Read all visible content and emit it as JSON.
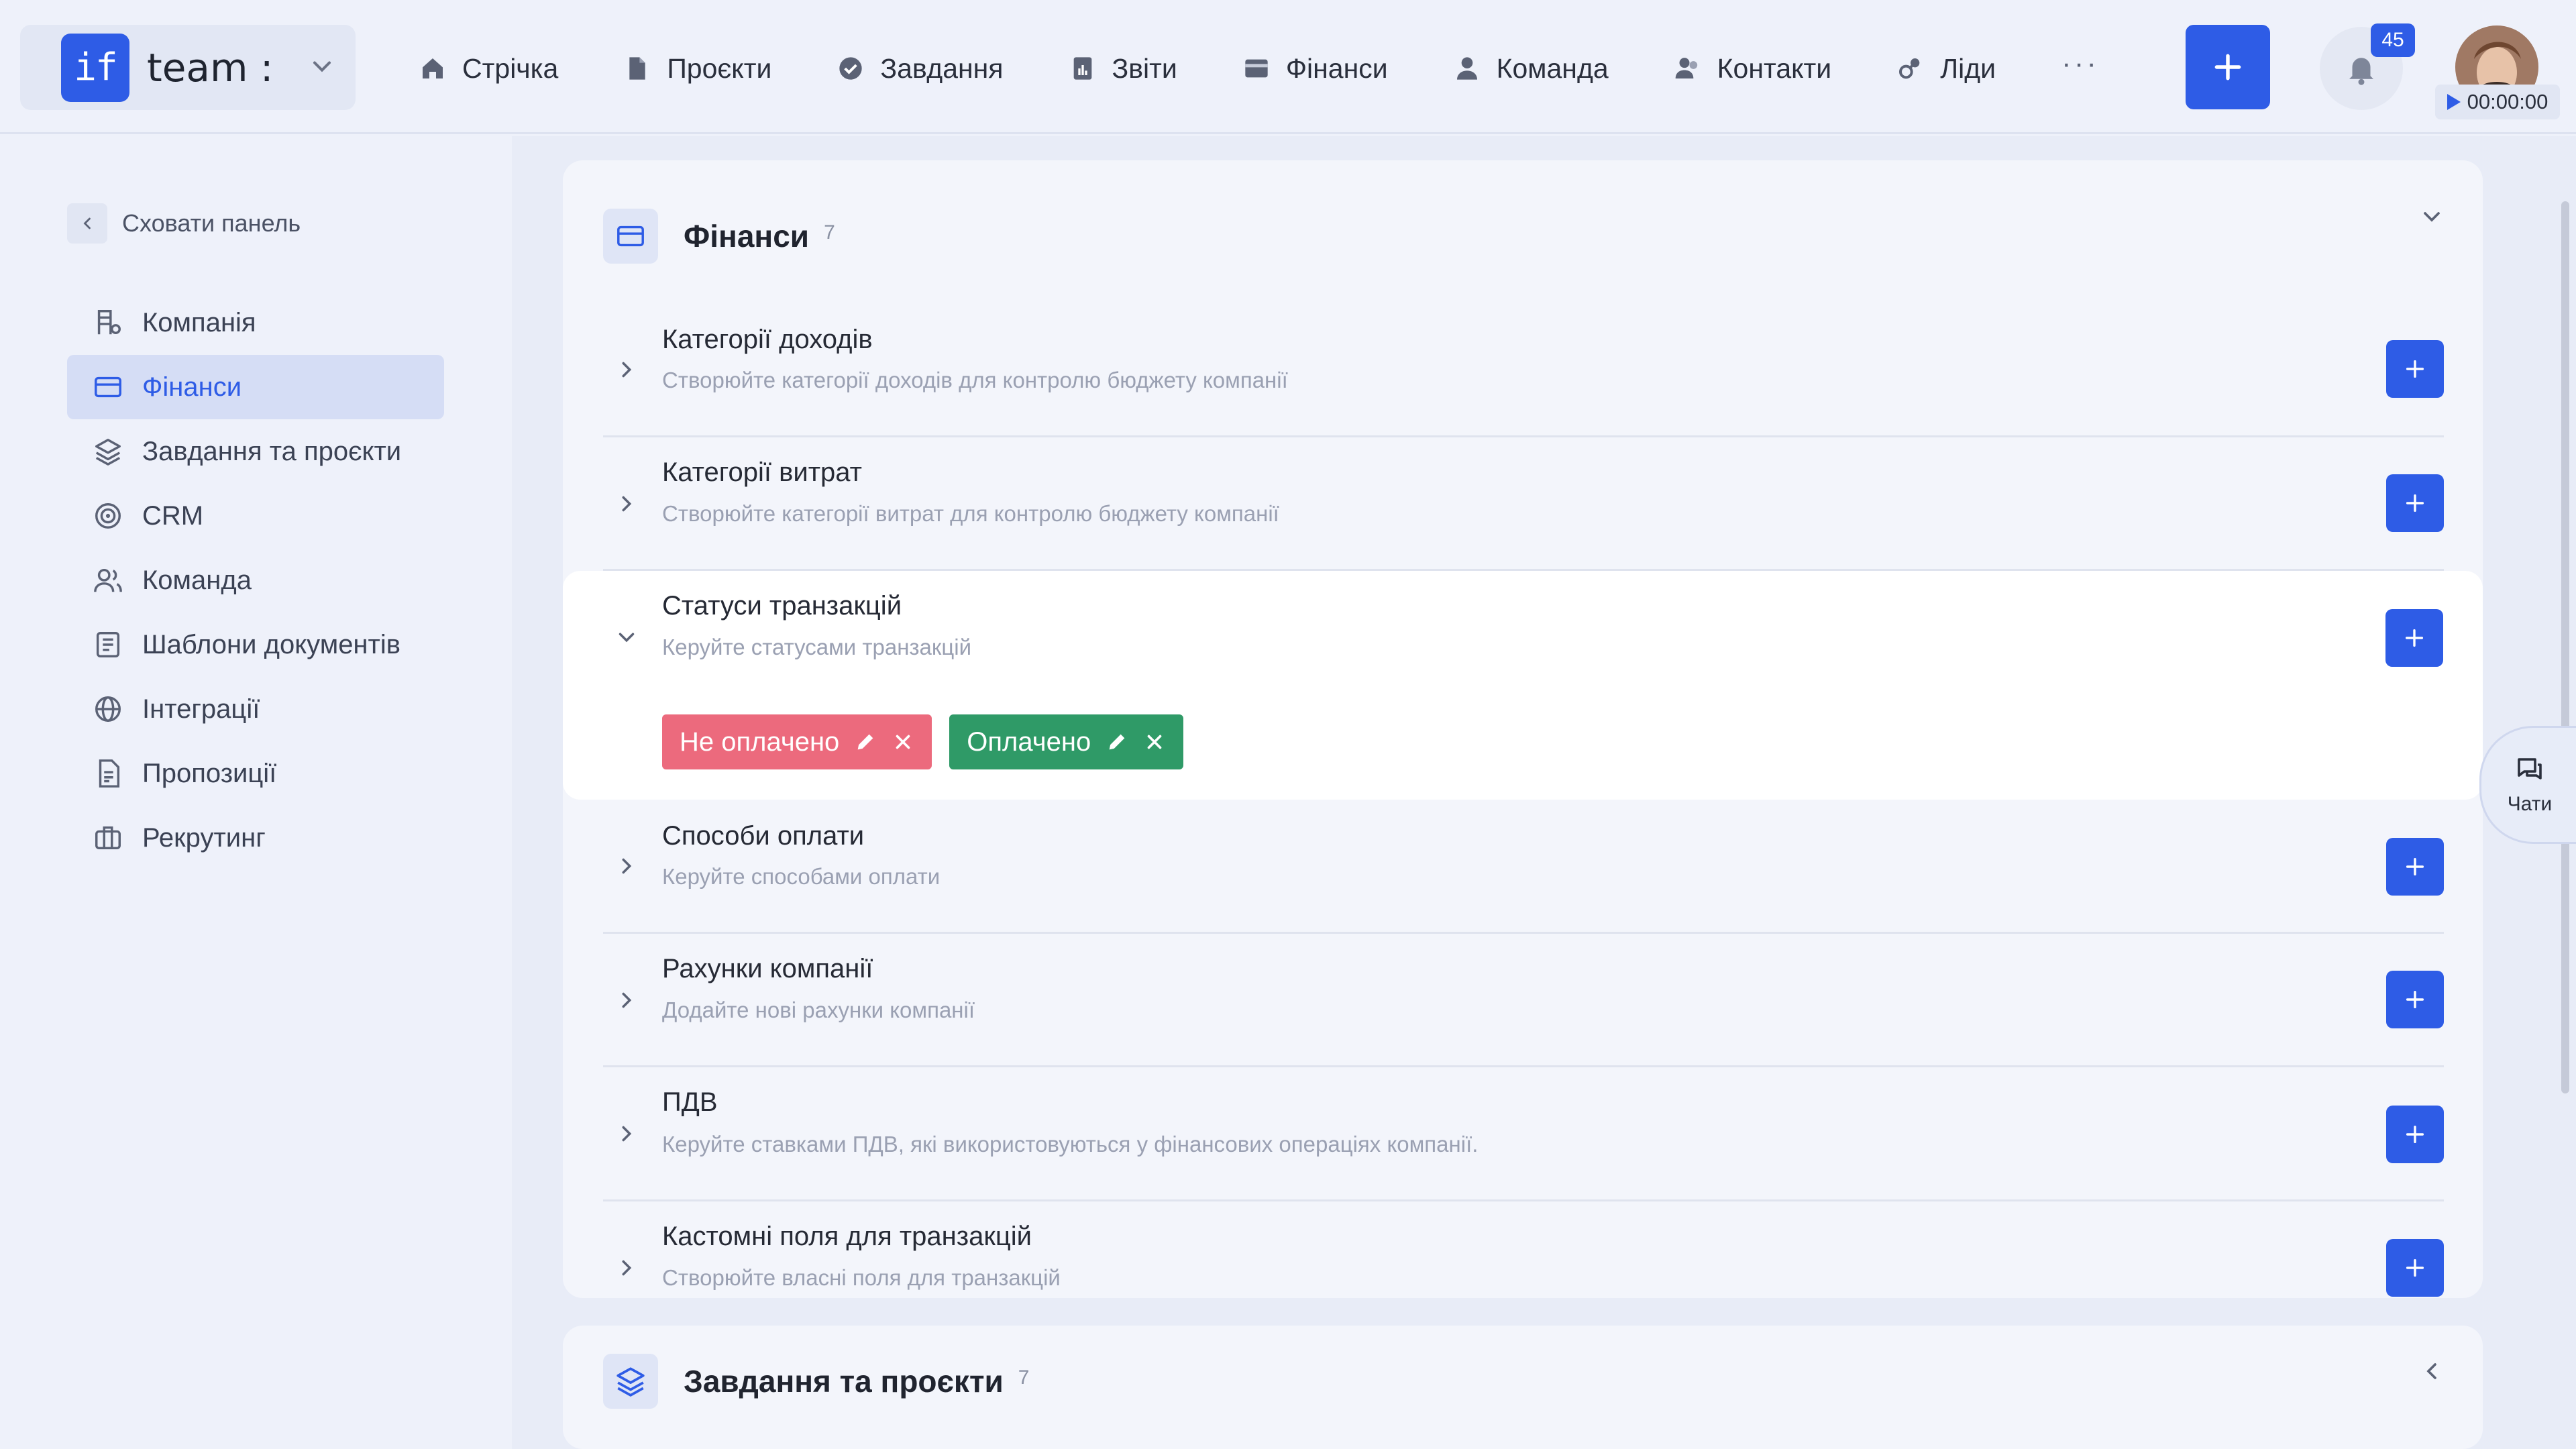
{
  "topbar": {
    "logo_text": "if",
    "team_name": "team :",
    "nav": [
      {
        "label": "Стрічка",
        "icon": "home-icon"
      },
      {
        "label": "Проєкти",
        "icon": "file-icon"
      },
      {
        "label": "Завдання",
        "icon": "check-circle-icon"
      },
      {
        "label": "Звіти",
        "icon": "report-icon"
      },
      {
        "label": "Фінанси",
        "icon": "wallet-icon"
      },
      {
        "label": "Команда",
        "icon": "user-icon"
      },
      {
        "label": "Контакти",
        "icon": "contacts-icon"
      },
      {
        "label": "Ліди",
        "icon": "leads-icon"
      }
    ],
    "more_label": "···",
    "notifications_count": "45",
    "timer": "00:00:00"
  },
  "sidebar": {
    "hide_label": "Сховати панель",
    "items": [
      {
        "label": "Компанія",
        "icon": "company-icon",
        "active": false
      },
      {
        "label": "Фінанси",
        "icon": "card-icon",
        "active": true
      },
      {
        "label": "Завдання та проєкти",
        "icon": "layers-icon",
        "active": false
      },
      {
        "label": "CRM",
        "icon": "target-icon",
        "active": false
      },
      {
        "label": "Команда",
        "icon": "team-icon",
        "active": false
      },
      {
        "label": "Шаблони документів",
        "icon": "document-template-icon",
        "active": false
      },
      {
        "label": "Інтеграції",
        "icon": "globe-icon",
        "active": false
      },
      {
        "label": "Пропозиції",
        "icon": "proposal-icon",
        "active": false
      },
      {
        "label": "Рекрутинг",
        "icon": "briefcase-icon",
        "active": false
      }
    ]
  },
  "finance_card": {
    "title": "Фінанси",
    "count": "7",
    "rows": [
      {
        "title": "Категорії доходів",
        "subtitle": "Створюйте категорії доходів для контролю бюджету компанії"
      },
      {
        "title": "Категорії витрат",
        "subtitle": "Створюйте категорії витрат для контролю бюджету компанії"
      },
      {
        "title": "Статуси транзакцій",
        "subtitle": "Керуйте статусами транзакцій",
        "expanded": true,
        "tags": [
          {
            "label": "Не оплачено",
            "color": "#ec6a7d"
          },
          {
            "label": "Оплачено",
            "color": "#2f9a67"
          }
        ]
      },
      {
        "title": "Способи оплати",
        "subtitle": "Керуйте способами оплати"
      },
      {
        "title": "Рахунки компанії",
        "subtitle": "Додайте нові рахунки компанії"
      },
      {
        "title": "ПДВ",
        "subtitle": "Керуйте ставками ПДВ, які використовуються у фінансових операціях компанії."
      },
      {
        "title": "Кастомні поля для транзакцій",
        "subtitle": "Створюйте власні поля для транзакцій"
      }
    ]
  },
  "tasks_card": {
    "title": "Завдання та проєкти",
    "count": "7"
  },
  "chats_label": "Чати",
  "colors": {
    "accent": "#2e5ce6",
    "unpaid": "#ec6a7d",
    "paid": "#2f9a67"
  }
}
